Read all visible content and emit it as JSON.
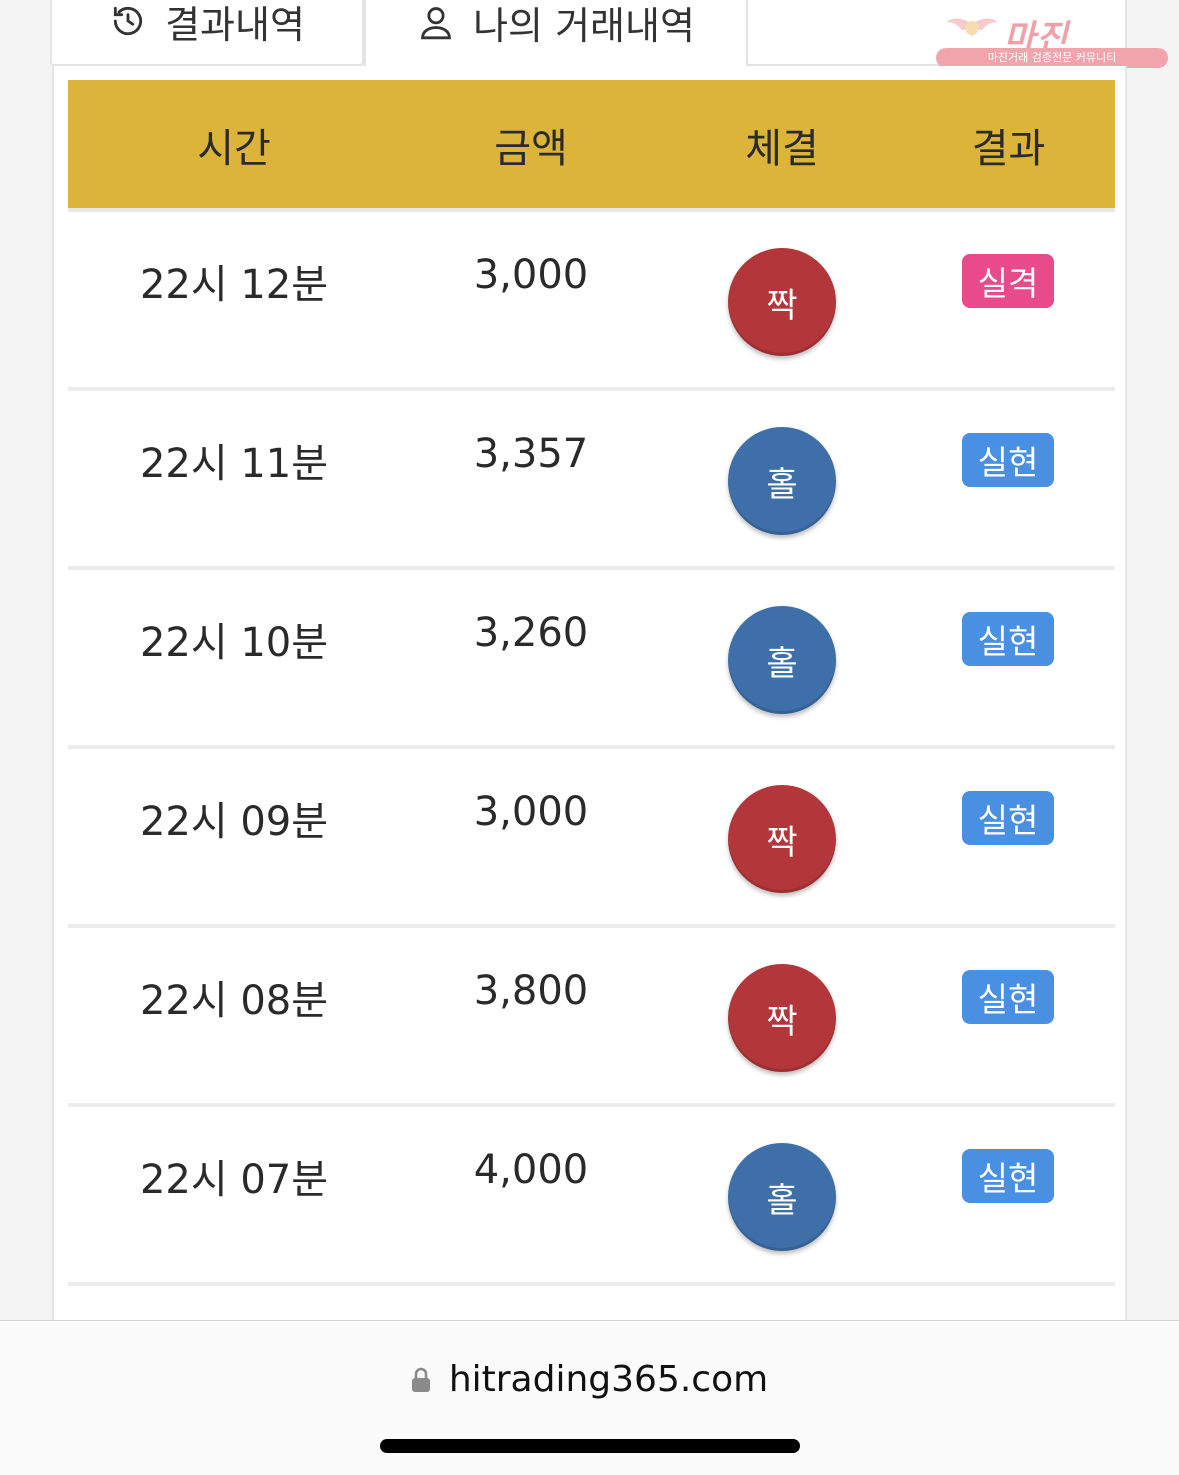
{
  "tabs": [
    {
      "label": "결과내역",
      "icon": "history-icon"
    },
    {
      "label": "나의 거래내역",
      "icon": "user-icon"
    },
    {
      "label": ""
    }
  ],
  "watermark": {
    "title": "마진",
    "subtitle": "마진거래 검증전문 커뮤니티"
  },
  "table": {
    "headers": {
      "time": "시간",
      "amount": "금액",
      "fill": "체결",
      "result": "결과"
    },
    "rows": [
      {
        "time": "22시 12분",
        "amount": "3,000",
        "fill": "짝",
        "result": "실격"
      },
      {
        "time": "22시 11분",
        "amount": "3,357",
        "fill": "홀",
        "result": "실현"
      },
      {
        "time": "22시 10분",
        "amount": "3,260",
        "fill": "홀",
        "result": "실현"
      },
      {
        "time": "22시 09분",
        "amount": "3,000",
        "fill": "짝",
        "result": "실현"
      },
      {
        "time": "22시 08분",
        "amount": "3,800",
        "fill": "짝",
        "result": "실현"
      },
      {
        "time": "22시 07분",
        "amount": "4,000",
        "fill": "홀",
        "result": "실현"
      }
    ]
  },
  "colors": {
    "header_bg": "#dcb43a",
    "chip_red": "#b2363a",
    "chip_blue": "#3e6fa8",
    "badge_pink": "#e84a8c",
    "badge_blue": "#4a90e2"
  },
  "browser": {
    "url": "hitrading365.com",
    "lock_icon": "lock-icon"
  }
}
